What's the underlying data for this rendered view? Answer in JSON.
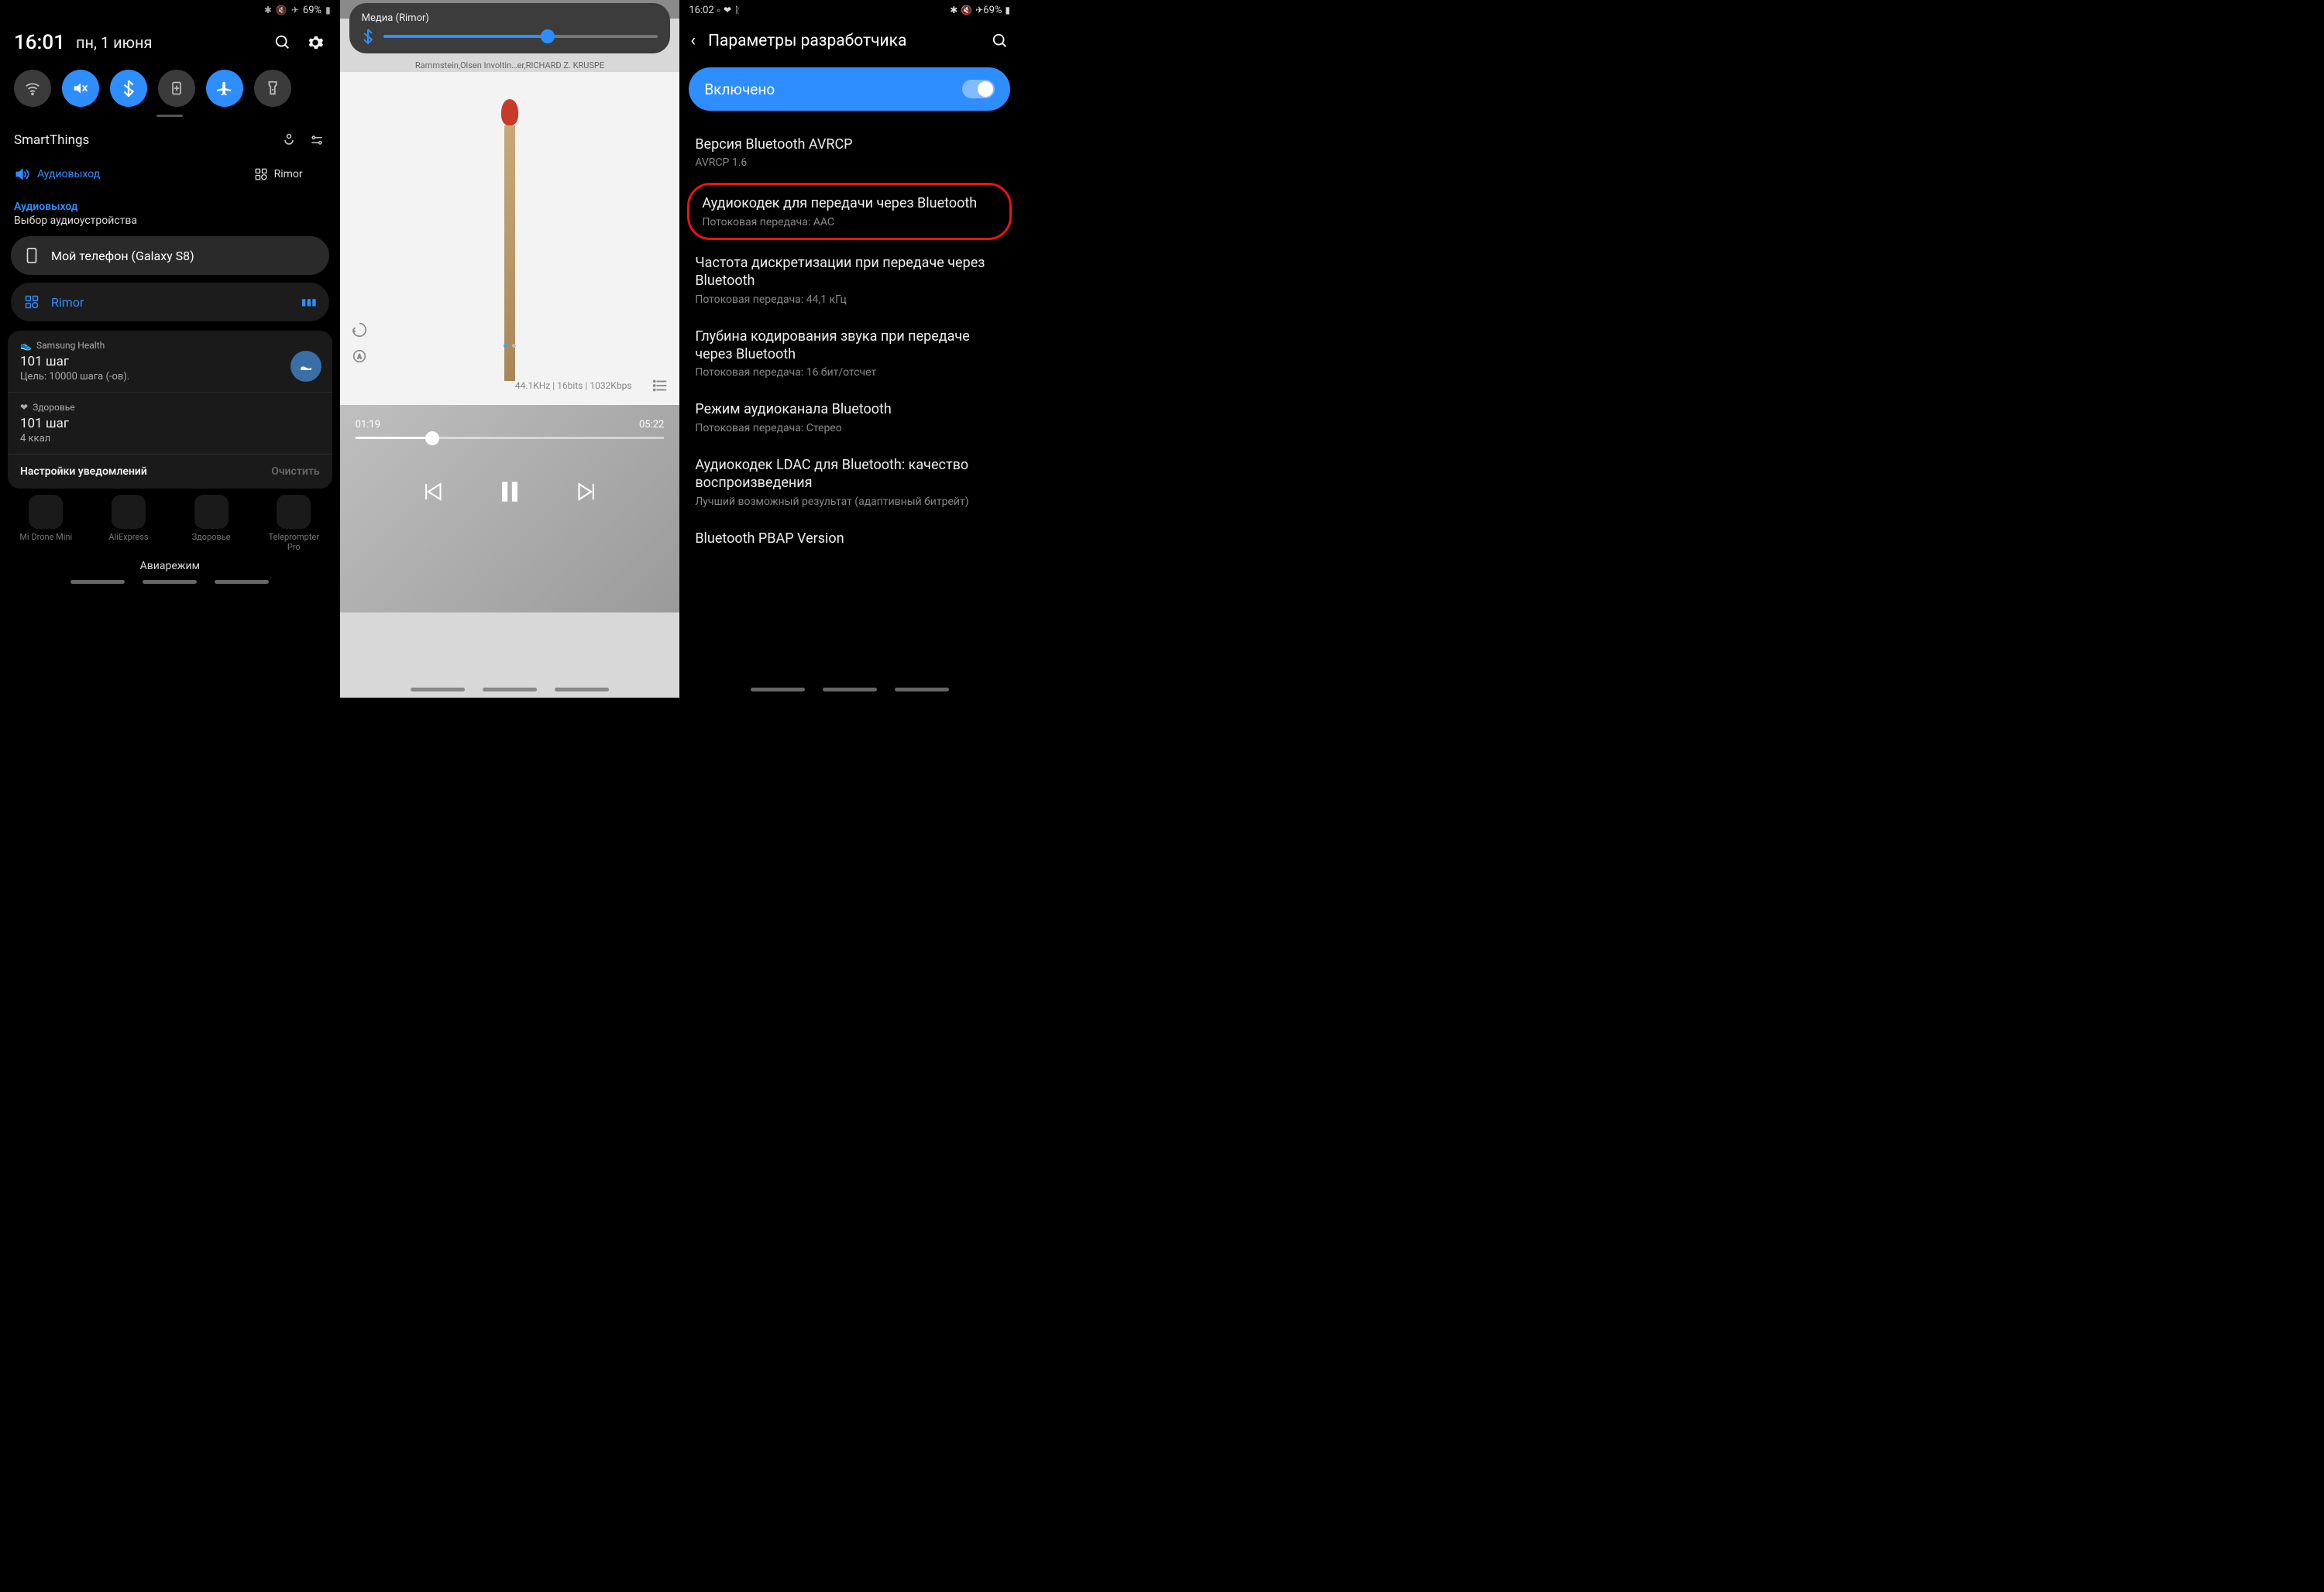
{
  "s1": {
    "status": {
      "battery": "69%",
      "icons_label": "bluetooth mute airplane"
    },
    "time": "16:01",
    "date": "пн, 1 июня",
    "qs": {
      "wifi": "wifi-icon",
      "mute": "mute-vibrate-icon",
      "bt": "bluetooth-icon",
      "data": "data-saver-icon",
      "air": "airplane-icon",
      "torch": "flashlight-icon"
    },
    "smartthings": "SmartThings",
    "st_audio_label": "Аудиовыход",
    "st_rimor": "Rimor",
    "audio_out": {
      "title": "Аудиовыход",
      "sub": "Выбор аудиоустройства"
    },
    "devices": {
      "phone": "Мой телефон (Galaxy S8)",
      "rimor": "Rimor"
    },
    "notif_health": {
      "app": "Samsung Health",
      "line": "101 шаг",
      "sub": "Цель: 10000 шага (-ов)."
    },
    "notif_z": {
      "app": "Здоровье",
      "line": "101 шаг",
      "sub": "4 ккал"
    },
    "footer": {
      "settings": "Настройки уведомлений",
      "clear": "Очистить"
    },
    "dock": {
      "a1": "Mi Drone Mini",
      "a2": "AliExpress",
      "a3": "Здоровье",
      "a4": "Teleprompter Pro"
    },
    "toast": "Авиарежим"
  },
  "s2": {
    "vol_title": "Медиа (Rimor)",
    "artist": "Rammstein,Olsen Involtin…er,RICHARD Z. KRUSPE",
    "meta": "44.1KHz | 16bits | 1032Kbps",
    "t_elapsed": "01:19",
    "t_total": "05:22"
  },
  "s3": {
    "status": {
      "time": "16:02",
      "battery": "69%"
    },
    "title": "Параметры разработчика",
    "enabled": "Включено",
    "opts": {
      "avrcp": {
        "t": "Версия Bluetooth AVRCP",
        "s": "AVRCP 1.6"
      },
      "codec": {
        "t": "Аудиокодек для передачи через Bluetooth",
        "s": "Потоковая передача: AAC"
      },
      "rate": {
        "t": "Частота дискретизации при передаче через Bluetooth",
        "s": "Потоковая передача: 44,1 кГц"
      },
      "depth": {
        "t": "Глубина кодирования звука при передаче через Bluetooth",
        "s": "Потоковая передача: 16 бит/отсчет"
      },
      "chan": {
        "t": "Режим аудиоканала Bluetooth",
        "s": "Потоковая передача: Стерео"
      },
      "ldac": {
        "t": "Аудиокодек LDAC для Bluetooth: качество воспроизведения",
        "s": "Лучший возможный результат (адаптивный битрейт)"
      },
      "pbap": {
        "t": "Bluetooth PBAP Version",
        "s": ""
      }
    }
  }
}
